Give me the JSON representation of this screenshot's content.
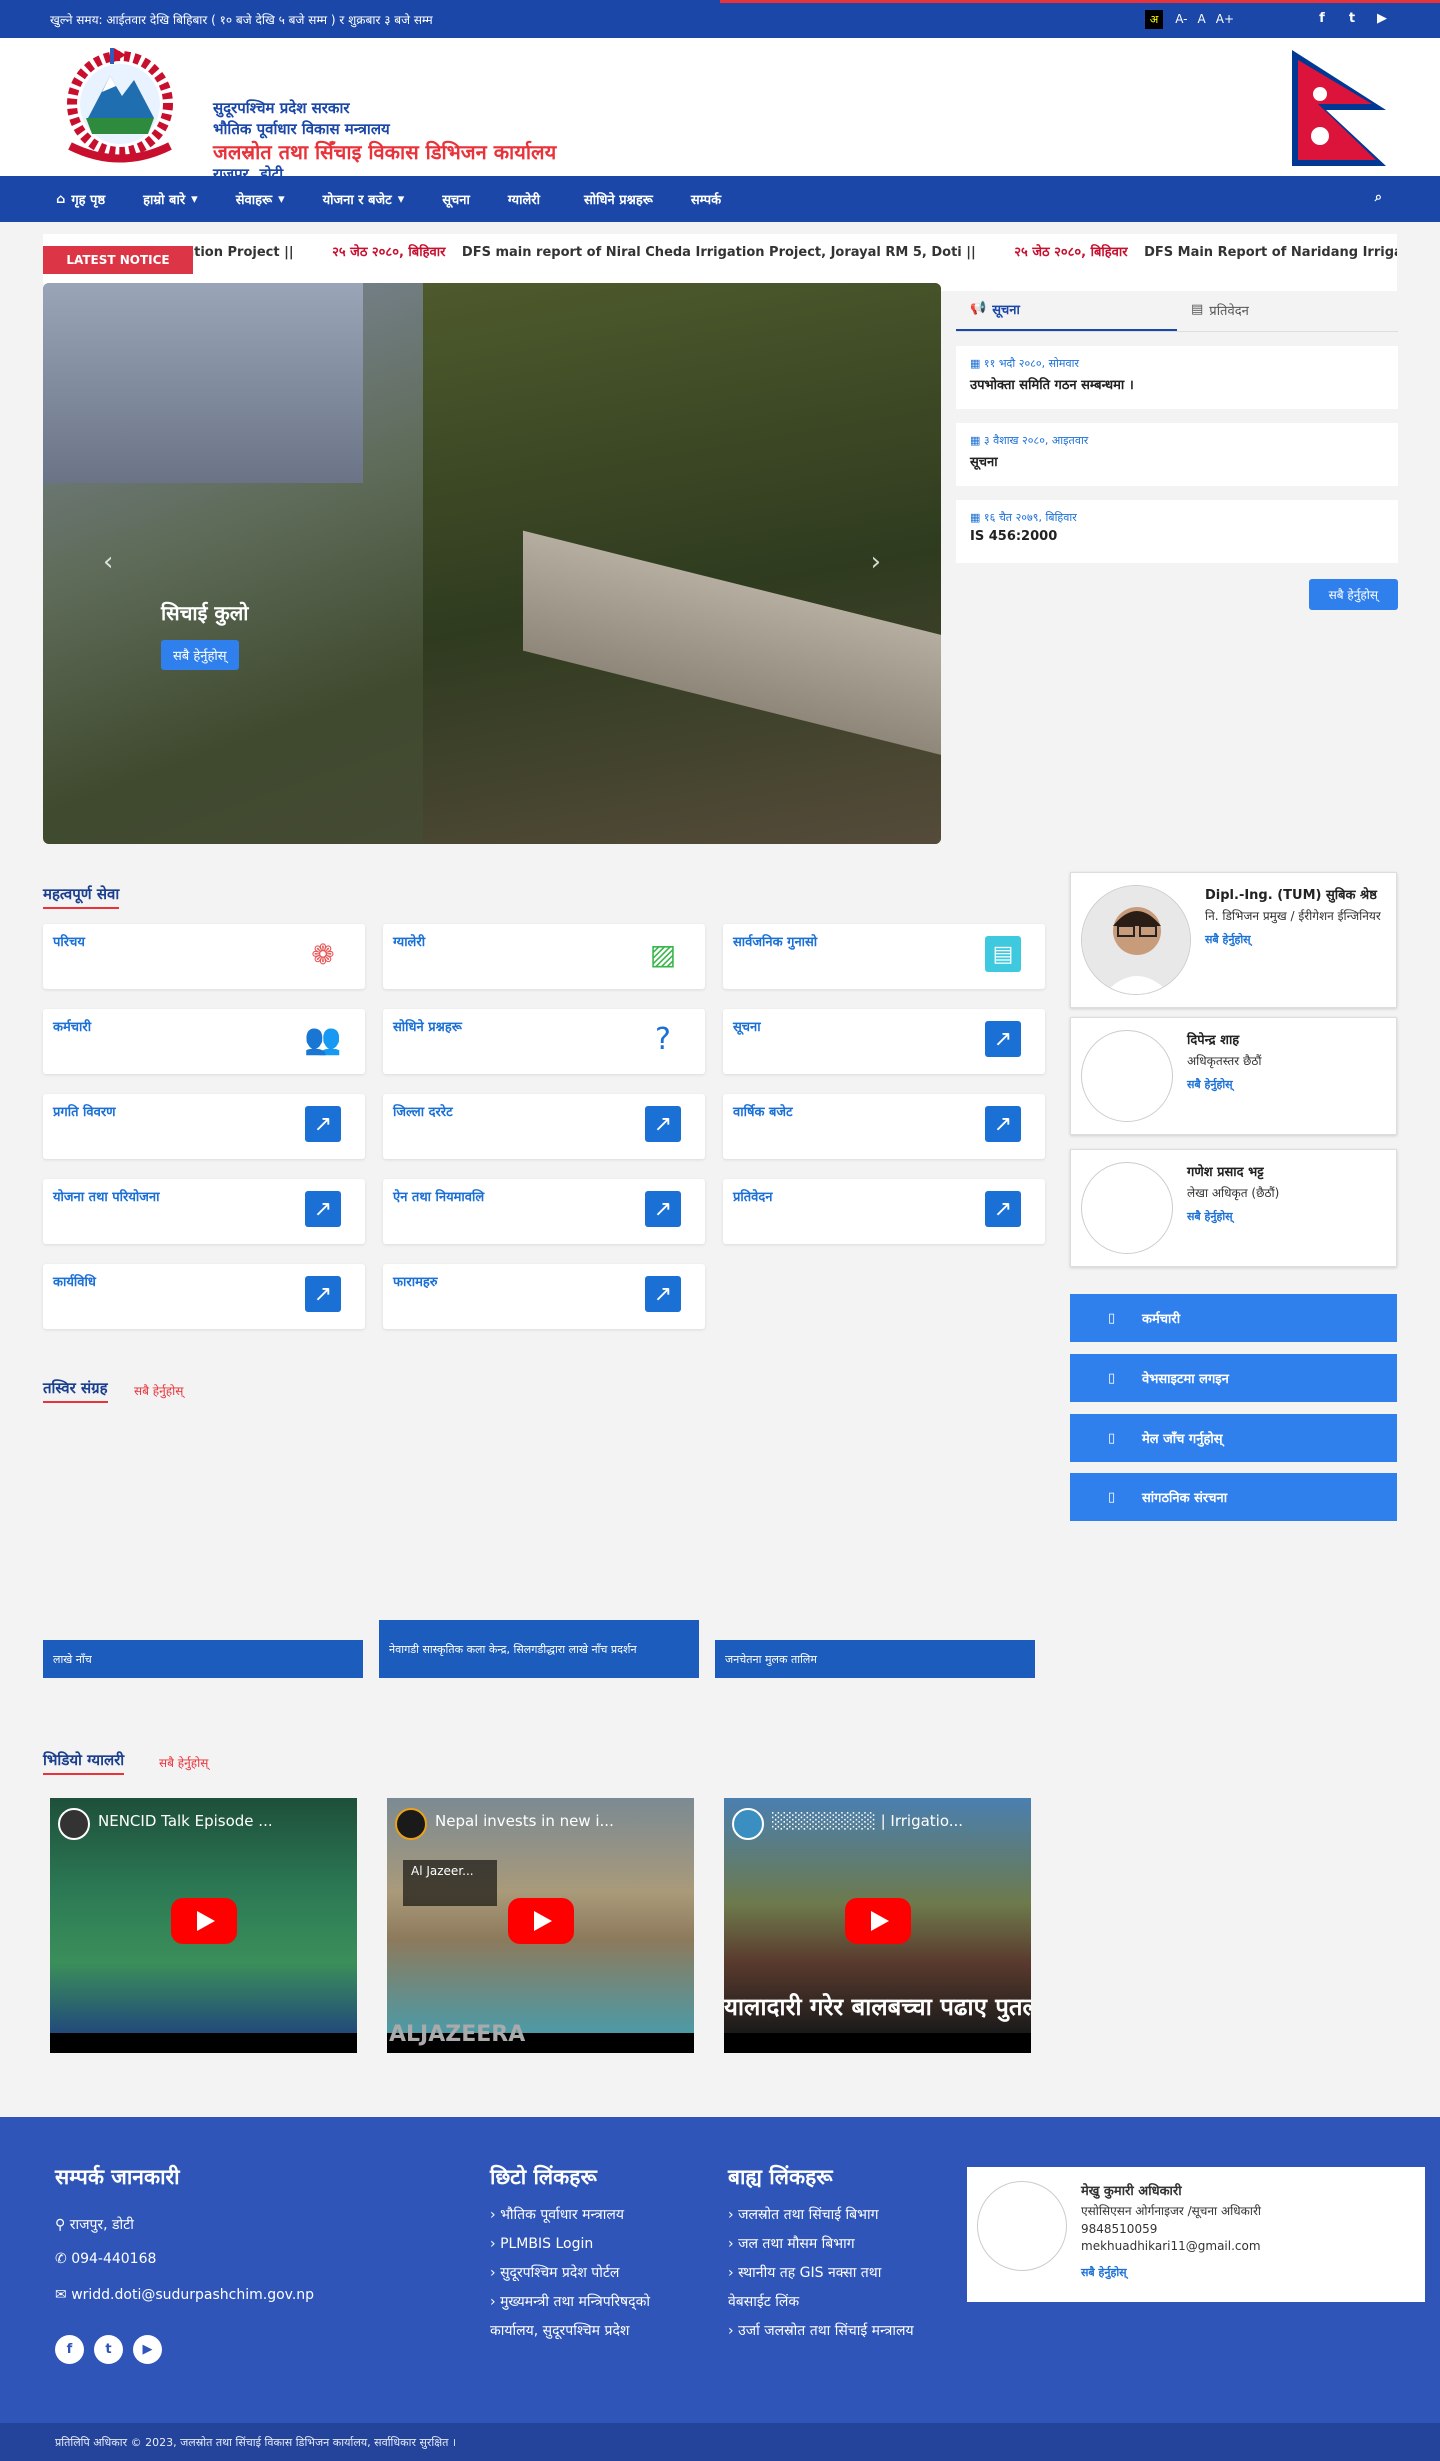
{
  "topbar": {
    "hours": "खुल्ने समय: आईतवार देखि बिहिबार ( १० बजे देखि ५ बजे सम्म ) र शुक्रबार ३ बजे सम्म",
    "lang": "अ",
    "font_small": "A-",
    "font_normal": "A",
    "font_large": "A+",
    "social": [
      "facebook-icon",
      "twitter-icon",
      "youtube-icon"
    ]
  },
  "header": {
    "line1": "सुदूरपश्चिम प्रदेश सरकार",
    "line2": "भौतिक पूर्वाधार विकास मन्त्रालय",
    "line3": "जलस्रोत तथा सिँचाइ विकास डिभिजन कार्यालय",
    "line4": "राजपुर, डोटी"
  },
  "nav": {
    "home": "गृह पृष्ठ",
    "about": "हाम्रो बारे",
    "services": "सेवाहरू",
    "budget": "योजना र बजेट",
    "notice": "सूचना",
    "gallery": "ग्यालेरी",
    "faq": "सोधिने प्रश्नहरू",
    "contact": "सम्पर्क"
  },
  "ticker": {
    "badge": "LATEST NOTICE",
    "items": [
      {
        "date": "",
        "text": "r Irrigation Project ||"
      },
      {
        "date": "२५ जेठ २०८०, बिहिवार",
        "text": "DFS main report of Niral Cheda Irrigation Project, Jorayal RM 5, Doti ||"
      },
      {
        "date": "२५ जेठ २०८०, बिहिवार",
        "text": "DFS Main Report of Naridang Irrigatio"
      }
    ]
  },
  "slider": {
    "caption": "सिचाई कुलो",
    "button": "सबै हेर्नुहोस्"
  },
  "notices": {
    "tab_notice": "सूचना",
    "tab_report": "प्रतिवेदन",
    "items": [
      {
        "date": "११ भदौ २०८०, सोमवार",
        "title": "उपभोक्ता समिति गठन सम्बन्धमा ।"
      },
      {
        "date": "३ वैशाख २०८०, आइतवार",
        "title": "सूचना"
      },
      {
        "date": "१६ चैत २०७९, बिहिवार",
        "title": "IS 456:2000"
      }
    ],
    "more": "सबै हेर्नुहोस्"
  },
  "services": {
    "title": "महत्वपूर्ण सेवा",
    "items": [
      {
        "label": "परिचय",
        "icon": "lotus-icon"
      },
      {
        "label": "ग्यालेरी",
        "icon": "images-icon"
      },
      {
        "label": "सार्वजनिक गुनासो",
        "icon": "id-card-icon"
      },
      {
        "label": "कर्मचारी",
        "icon": "users-icon"
      },
      {
        "label": "सोधिने प्रश्नहरू",
        "icon": "question-icon"
      },
      {
        "label": "सूचना",
        "icon": "external-link-icon"
      },
      {
        "label": "प्रगति विवरण",
        "icon": "external-link-icon"
      },
      {
        "label": "जिल्ला दररेट",
        "icon": "external-link-icon"
      },
      {
        "label": "वार्षिक बजेट",
        "icon": "external-link-icon"
      },
      {
        "label": "योजना तथा परियोजना",
        "icon": "external-link-icon"
      },
      {
        "label": "ऐन तथा नियमावलि",
        "icon": "external-link-icon"
      },
      {
        "label": "प्रतिवेदन",
        "icon": "external-link-icon"
      },
      {
        "label": "कार्यविधि",
        "icon": "external-link-icon"
      },
      {
        "label": "फारामहरु",
        "icon": "external-link-icon"
      }
    ]
  },
  "gallery": {
    "title": "तस्विर संग्रह",
    "more": "सबै हेर्नुहोस्",
    "items": [
      "लाखे नाँच",
      "नेवागडी सास्कृतिक कला केन्द्र, सिलगडीद्धारा लाखे नाँच प्रदर्शन",
      "जनचेतना मुलक तालिम"
    ]
  },
  "videos": {
    "title": "भिडियो ग्यालरी",
    "more": "सबै हेर्नुहोस्",
    "items": [
      {
        "title": "NENCID Talk Episode ..."
      },
      {
        "title": "Nepal invests in new i...",
        "overlay": "Al Jazeer...",
        "brand": "ALJAZEERA"
      },
      {
        "title": "░░░░░░░░░ | Irrigatio...",
        "big": "यालादारी गरेर बालबच्चा पढाए पुतलीले..."
      }
    ]
  },
  "staff": [
    {
      "name": "Dipl.-Ing. (TUM) सुबिक श्रेष्ठ",
      "post": "नि. डिभिजन प्रमुख / ईरीगेशन ईन्जिनियर",
      "more": "सबै हेर्नुहोस्"
    },
    {
      "name": "दिपेन्द्र शाह",
      "post": "अधिकृतस्तर छैठौं",
      "more": "सबै हेर्नुहोस्"
    },
    {
      "name": "गणेश प्रसाद भट्ट",
      "post": "लेखा अधिकृत (छैठौं)",
      "more": "सबै हेर्नुहोस्"
    }
  ],
  "quicklinks": [
    {
      "label": "कर्मचारी",
      "icon": "users-icon"
    },
    {
      "label": "वेभसाइटमा लगइन",
      "icon": "login-icon"
    },
    {
      "label": "मेल जाँच गर्नुहोस्",
      "icon": "mail-icon"
    },
    {
      "label": "सांगठनिक संरचना",
      "icon": "sitemap-icon"
    }
  ],
  "footer": {
    "contact_title": "सम्पर्क जानकारी",
    "address": "राजपुर, डोटी",
    "phone": "094-440168",
    "email": "wridd.doti@sudurpashchim.gov.np",
    "quick_title": "छिटो लिंकहरू",
    "quick": [
      "भौतिक पूर्वाधार मन्त्रालय",
      "PLMBIS Login",
      "सुदूरपश्चिम प्रदेश पोर्टल",
      "मुख्यमन्त्री तथा मन्त्रिपरिषद्को कार्यालय, सुदूरपश्चिम प्रदेश"
    ],
    "ext_title": "बाह्य लिंकहरू",
    "ext": [
      "जलस्रोत तथा सिंचाई बिभाग",
      "जल तथा मौसम बिभाग",
      "स्थानीय तह GIS नक्सा तथा वेबसाईट लिंक",
      "उर्जा जलस्रोत तथा सिंचाई मन्त्रालय"
    ],
    "info_officer": {
      "name": "मेखु कुमारी अधिकारी",
      "post": "एसोसिएसन ओर्गनाइजर /सूचना अधिकारी",
      "phone": "9848510059",
      "email": "mekhuadhikari11@gmail.com",
      "more": "सबै हेर्नुहोस्"
    }
  },
  "copyright": "प्रतिलिपि अधिकार © 2023, जलस्रोत तथा सिंचाई विकास डिभिजन कार्यालय, सर्वाधिकार सुरक्षित ।"
}
